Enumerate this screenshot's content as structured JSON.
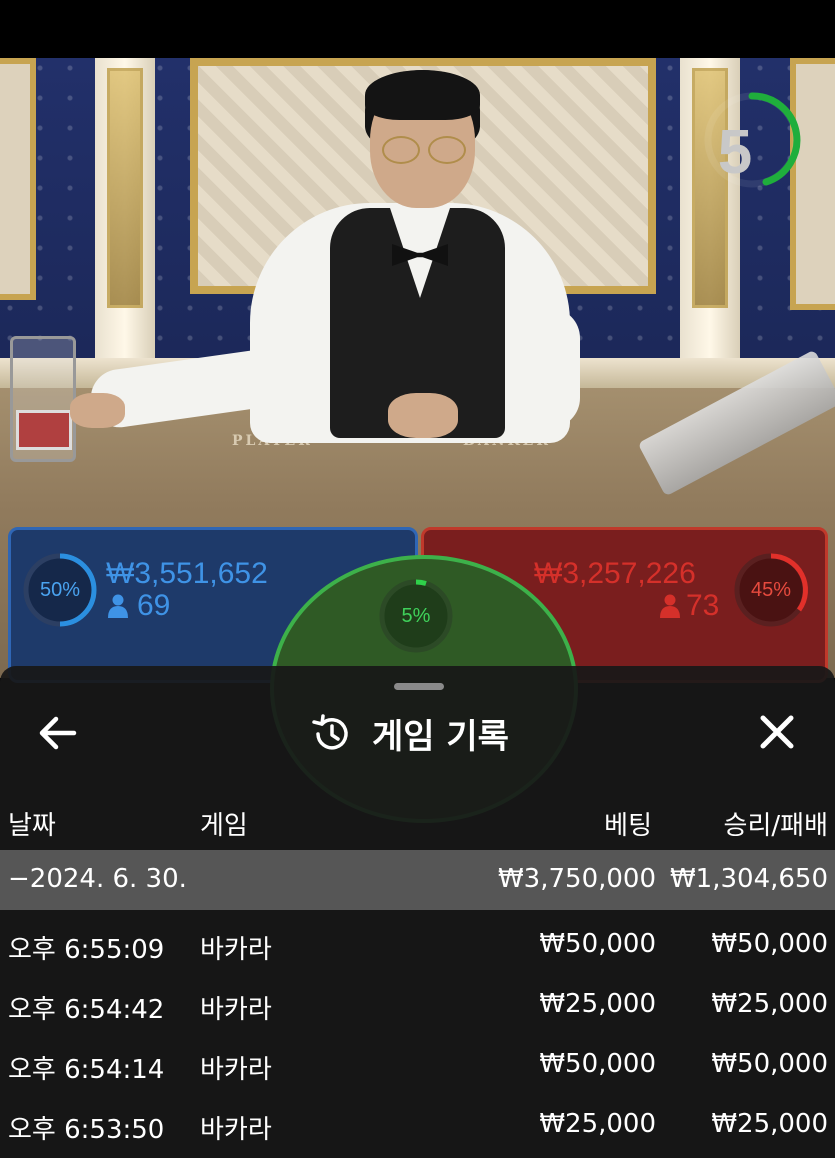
{
  "game": {
    "timer": "5",
    "felt_labels": {
      "player": "PLAYER",
      "banker": "BANKER"
    },
    "player_bet": {
      "percent": "50%",
      "amount": "₩3,551,652",
      "count": "69",
      "color": "#2f66b5"
    },
    "banker_bet": {
      "percent": "45%",
      "amount": "₩3,257,226",
      "count": "73",
      "color": "#c0392b"
    },
    "tie_bet": {
      "percent": "5%",
      "color": "#3db14a"
    }
  },
  "history_sheet": {
    "title": "게임 기록",
    "back_icon": "arrow-left-icon",
    "close_icon": "close-icon",
    "title_icon": "history-icon",
    "columns": {
      "date": "날짜",
      "game": "게임",
      "bet": "베팅",
      "win_loss": "승리/패배"
    },
    "date_group": {
      "label": "−2024. 6. 30.",
      "bet_total": "₩3,750,000",
      "win_loss_total": "₩1,304,650"
    },
    "rows": [
      {
        "time": "오후 6:55:09",
        "game": "바카라",
        "bet": "₩50,000",
        "win_loss": "₩50,000"
      },
      {
        "time": "오후 6:54:42",
        "game": "바카라",
        "bet": "₩25,000",
        "win_loss": "₩25,000"
      },
      {
        "time": "오후 6:54:14",
        "game": "바카라",
        "bet": "₩50,000",
        "win_loss": "₩50,000"
      },
      {
        "time": "오후 6:53:50",
        "game": "바카라",
        "bet": "₩25,000",
        "win_loss": "₩25,000"
      }
    ]
  }
}
